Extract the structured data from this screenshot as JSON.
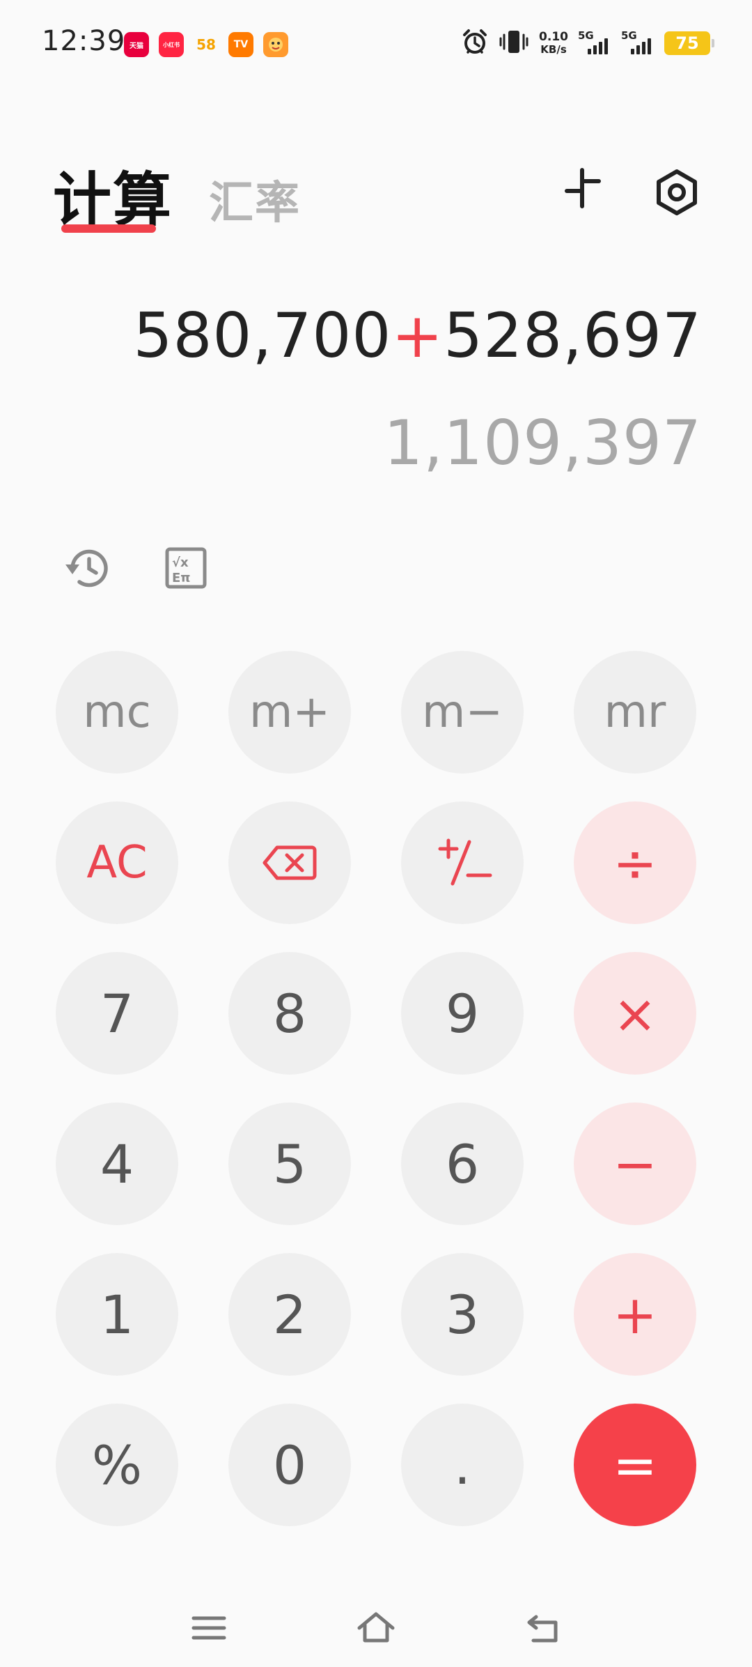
{
  "status_bar": {
    "time": "12:39",
    "net_speed_value": "0.10",
    "net_speed_unit": "KB/s",
    "sim1_label": "5G",
    "sim2_label": "5G",
    "battery_level": "75",
    "notification_apps": [
      {
        "name": "tmall-app-icon",
        "label": "天猫",
        "color": "#e8003d"
      },
      {
        "name": "xiaohongshu-app-icon",
        "label": "小红书",
        "color": "#ff2442"
      },
      {
        "name": "58-app-icon",
        "label": "58",
        "color": "#ffffff"
      },
      {
        "name": "mango-tv-app-icon",
        "label": "TV",
        "color": "#ff7a00"
      },
      {
        "name": "game-app-icon",
        "label": "",
        "color": "#ff9a2e"
      }
    ]
  },
  "header": {
    "tab_calculator": "计算",
    "tab_exchange_rate": "汇率",
    "accent_color": "#f0414b"
  },
  "display": {
    "operand1": "580,700",
    "operator": "+",
    "operand2": "528,697",
    "result": "1,109,397"
  },
  "keypad": {
    "mc": "mc",
    "m_plus": "m+",
    "m_minus": "m−",
    "mr": "mr",
    "ac": "AC",
    "seven": "7",
    "eight": "8",
    "nine": "9",
    "four": "4",
    "five": "5",
    "six": "6",
    "one": "1",
    "two": "2",
    "three": "3",
    "percent": "%",
    "zero": "0",
    "dot": ".",
    "divide": "÷",
    "multiply": "×",
    "minus": "−",
    "plus": "+",
    "equals": "="
  }
}
